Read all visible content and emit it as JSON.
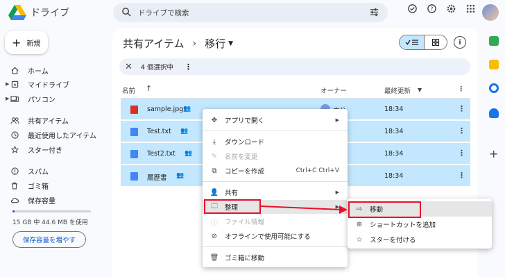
{
  "app": {
    "title": "ドライブ"
  },
  "search": {
    "placeholder": "ドライブで検索"
  },
  "sidebar": {
    "new_label": "新規",
    "items": [
      {
        "label": "ホーム",
        "icon": "home-icon"
      },
      {
        "label": "マイドライブ",
        "icon": "my-drive-icon"
      },
      {
        "label": "パソコン",
        "icon": "computer-icon"
      },
      {
        "label": "共有アイテム",
        "icon": "shared-icon"
      },
      {
        "label": "最近使用したアイテム",
        "icon": "clock-icon"
      },
      {
        "label": "スター付き",
        "icon": "star-icon"
      },
      {
        "label": "スパム",
        "icon": "spam-icon"
      },
      {
        "label": "ゴミ箱",
        "icon": "trash-icon"
      },
      {
        "label": "保存容量",
        "icon": "cloud-icon"
      }
    ],
    "storage_text": "15 GB 中 44.6 MB を使用",
    "storage_fraction": 0.003,
    "more_storage_label": "保存容量を増やす"
  },
  "main": {
    "breadcrumb_root": "共有アイテム",
    "breadcrumb_sep": "›",
    "breadcrumb_current": "移行",
    "selection_text": "4 個選択中",
    "columns": {
      "name": "名前",
      "owner": "オーナー",
      "modified": "最終更新"
    },
    "files": [
      {
        "name": "sample.jpg",
        "type": "image",
        "color": "#d93025",
        "time": "18:34",
        "owner": "自分"
      },
      {
        "name": "Test.txt",
        "type": "doc",
        "color": "#4285f4",
        "time": "18:34"
      },
      {
        "name": "Test2.txt",
        "type": "doc",
        "color": "#4285f4",
        "time": "18:34"
      },
      {
        "name": "履歴書",
        "type": "doc",
        "color": "#4285f4",
        "time": "18:34"
      }
    ]
  },
  "context_menu": {
    "items": [
      {
        "label": "アプリで開く",
        "icon": "open-with-icon",
        "arrow": "▶"
      },
      {
        "label": "ダウンロード",
        "icon": "download-icon"
      },
      {
        "label": "名前を変更",
        "icon": "rename-icon",
        "disabled": true
      },
      {
        "label": "コピーを作成",
        "icon": "copy-icon",
        "shortcut": "Ctrl+C Ctrl+V"
      },
      {
        "label": "共有",
        "icon": "share-icon",
        "arrow": "▶"
      },
      {
        "label": "整理",
        "icon": "organize-icon",
        "arrow": "▶"
      },
      {
        "label": "ファイル情報",
        "icon": "info-icon",
        "disabled": true
      },
      {
        "label": "オフラインで使用可能にする",
        "icon": "offline-icon"
      },
      {
        "label": "ゴミ箱に移動",
        "icon": "trash-icon"
      }
    ]
  },
  "submenu": {
    "items": [
      {
        "label": "移動",
        "icon": "move-folder-icon"
      },
      {
        "label": "ショートカットを追加",
        "icon": "add-shortcut-icon"
      },
      {
        "label": "スターを付ける",
        "icon": "star-icon"
      }
    ]
  },
  "colors": {
    "accent": "#0b57d0",
    "selection": "#c2e7ff",
    "highlight_box": "#e8102a"
  }
}
